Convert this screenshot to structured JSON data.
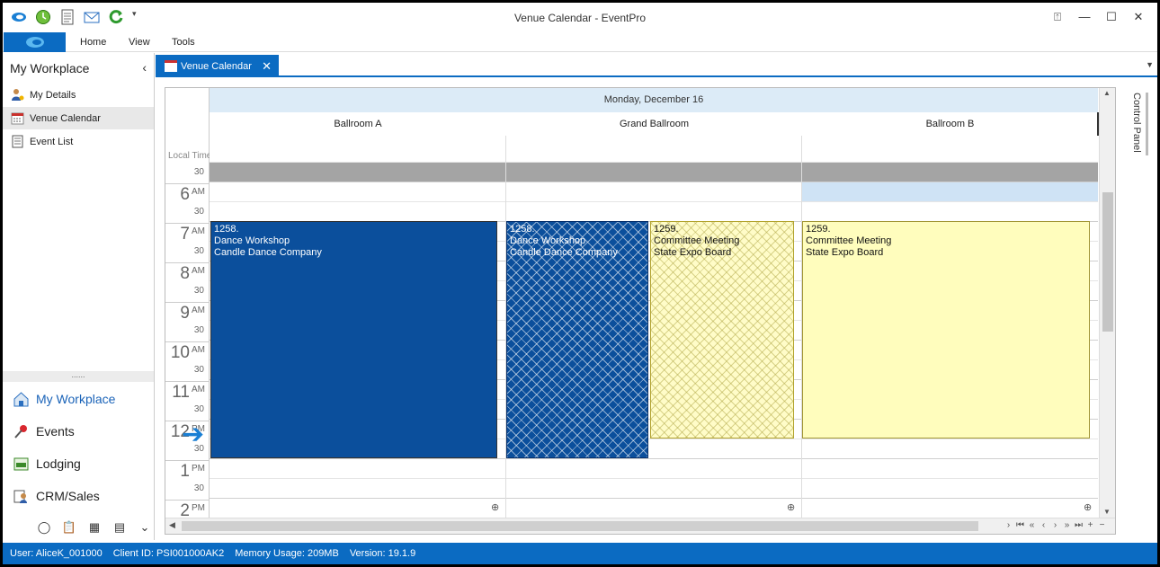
{
  "app": {
    "title": "Venue Calendar - EventPro"
  },
  "ribbon": {
    "tabs": [
      "Home",
      "View",
      "Tools"
    ]
  },
  "nav": {
    "title": "My Workplace",
    "items": [
      {
        "label": "My Details",
        "icon": "user-icon",
        "selected": false
      },
      {
        "label": "Venue Calendar",
        "icon": "calendar-icon",
        "selected": true
      },
      {
        "label": "Event List",
        "icon": "document-list-icon",
        "selected": false
      }
    ],
    "sections": [
      {
        "label": "My Workplace",
        "icon": "home-icon",
        "active": true
      },
      {
        "label": "Events",
        "icon": "pushpin-icon",
        "active": false
      },
      {
        "label": "Lodging",
        "icon": "lodging-icon",
        "active": false
      },
      {
        "label": "CRM/Sales",
        "icon": "contacts-icon",
        "active": false
      }
    ]
  },
  "doc_tab": {
    "label": "Venue Calendar"
  },
  "calendar": {
    "date": "Monday, December 16",
    "resources": [
      "Ballroom A",
      "Grand Ballroom",
      "Ballroom B"
    ],
    "time_header": "Local Time",
    "hours": [
      {
        "hour": "6",
        "ampm": "AM"
      },
      {
        "hour": "7",
        "ampm": "AM"
      },
      {
        "hour": "8",
        "ampm": "AM"
      },
      {
        "hour": "9",
        "ampm": "AM"
      },
      {
        "hour": "10",
        "ampm": "AM"
      },
      {
        "hour": "11",
        "ampm": "AM"
      },
      {
        "hour": "12",
        "ampm": "PM"
      },
      {
        "hour": "1",
        "ampm": "PM"
      },
      {
        "hour": "2",
        "ampm": "PM"
      }
    ],
    "half_label": "30",
    "appointments": [
      {
        "id": "1258.",
        "title": "Dance Workshop",
        "client": "Candle Dance Company",
        "style": "blue"
      },
      {
        "id": "1258.",
        "title": "Dance Workshop",
        "client": "Candle Dance Company",
        "style": "bluehatch"
      },
      {
        "id": "1259.",
        "title": "Committee Meeting",
        "client": "State Expo Board",
        "style": "yellowhatch"
      },
      {
        "id": "1259.",
        "title": "Committee Meeting",
        "client": "State Expo Board",
        "style": "yellow"
      }
    ]
  },
  "control_panel": "Control Panel",
  "status": {
    "user": "User: AliceK_001000",
    "client": "Client ID: PSI001000AK2",
    "memory": "Memory Usage: 209MB",
    "version": "Version: 19.1.9"
  },
  "colors": {
    "accent": "#0b6bc2",
    "appt_blue": "#0b4f9c",
    "appt_yellow": "#fffdbd",
    "date_header": "#dcebf7"
  }
}
